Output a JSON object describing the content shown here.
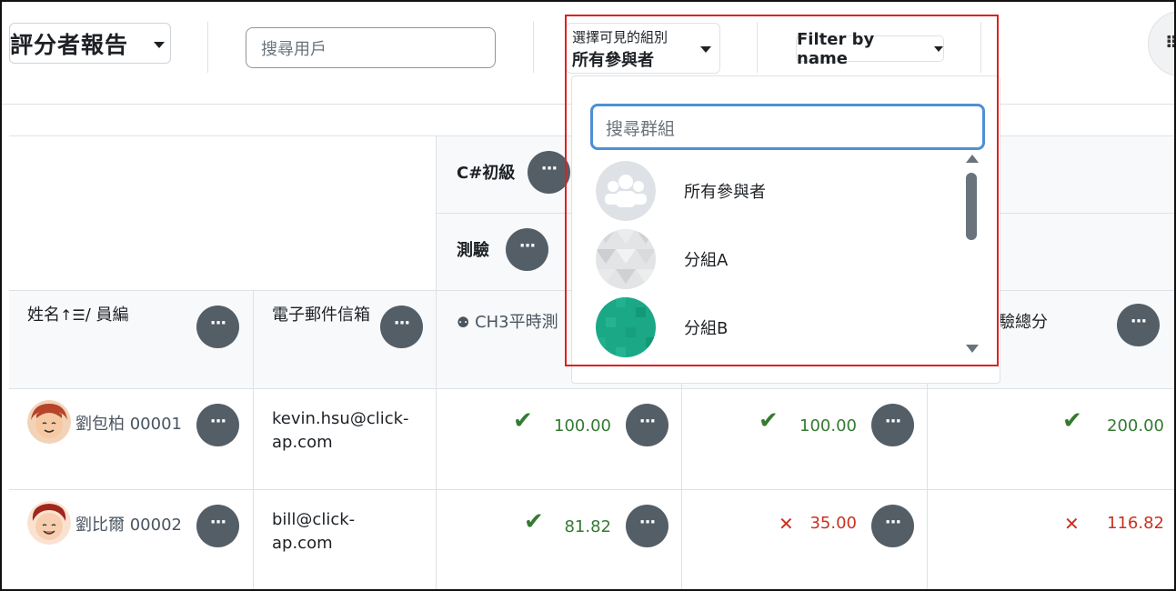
{
  "header": {
    "report_title": "評分者報告",
    "user_search_placeholder": "搜尋用戶",
    "group_select_small": "選擇可見的組別",
    "group_select_value": "所有參與者",
    "filter_by_name": "Filter by name"
  },
  "dropdown": {
    "search_placeholder": "搜尋群組",
    "options": [
      {
        "label": "所有參與者",
        "icon": "group-placeholder-icon"
      },
      {
        "label": "分組A",
        "icon": "group-a-pattern-icon"
      },
      {
        "label": "分組B",
        "icon": "group-b-pattern-icon"
      }
    ]
  },
  "table": {
    "category_course": "C#初級",
    "category_quiz": "測驗",
    "col_name": "姓名",
    "col_name_sep": "/ 員編",
    "col_email": "電子郵件信箱",
    "col_item": "CH3平時測",
    "col_total": "驗總分",
    "rows": [
      {
        "name": "劉包柏 00001",
        "email": "kevin.hsu@click-ap.com",
        "email_l1": "kevin.hsu@click-",
        "email_l2": "ap.com",
        "g1": "100.00",
        "g2": "100.00",
        "g3": "200.00"
      },
      {
        "name": "劉比爾 00002",
        "email": "bill@click-ap.com",
        "email_l1": "bill@click-",
        "email_l2": "ap.com",
        "g1": "81.82",
        "g2": "35.00",
        "g3": "116.82"
      }
    ],
    "colors": {
      "pass": "#357a32",
      "fail": "#ca3120",
      "action_btn": "#545e67"
    }
  }
}
